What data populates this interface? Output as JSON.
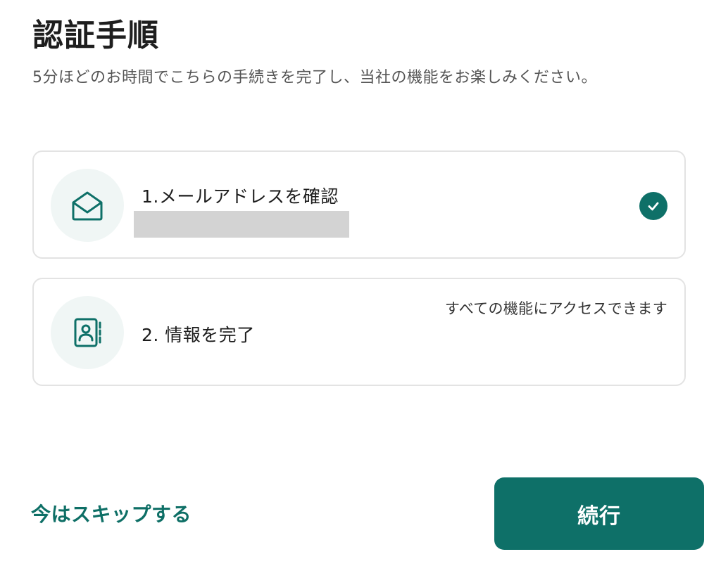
{
  "header": {
    "title": "認証手順",
    "subtitle": "5分ほどのお時間でこちらの手続きを完了し、当社の機能をお楽しみください。"
  },
  "steps": [
    {
      "title": "1.メールアドレスを確認",
      "icon": "envelope-open-icon",
      "status": "completed"
    },
    {
      "title": "2. 情報を完了",
      "icon": "contact-book-icon",
      "hint": "すべての機能にアクセスできます"
    }
  ],
  "actions": {
    "skip_label": "今はスキップする",
    "continue_label": "続行"
  },
  "colors": {
    "accent": "#0e7068",
    "icon_bg": "#f0f6f5",
    "redaction": "#d3d3d3"
  }
}
